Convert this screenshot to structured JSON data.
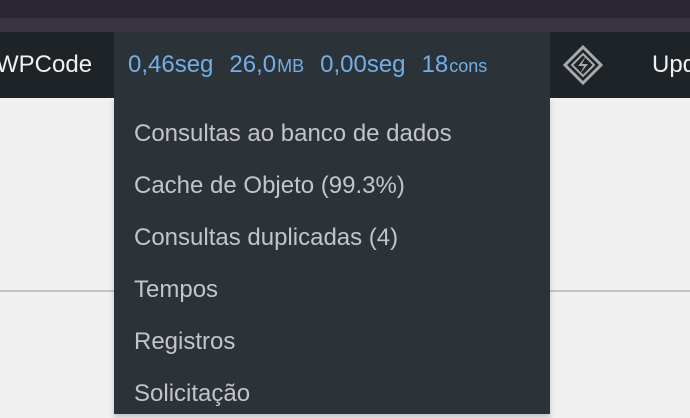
{
  "adminbar": {
    "wpcode_label": "WPCode",
    "qm": {
      "time": {
        "value": "0,46seg"
      },
      "memory": {
        "value": "26,0",
        "unit": "MB"
      },
      "db_time": {
        "value": "0,00seg"
      },
      "queries": {
        "value": "18",
        "unit": "cons"
      }
    },
    "icon": "diamond-logo-icon",
    "updates_label": "Upd"
  },
  "dropdown": {
    "items": [
      {
        "label": "Consultas ao banco de dados"
      },
      {
        "label": "Cache de Objeto (99.3%)"
      },
      {
        "label": "Consultas duplicadas (4)"
      },
      {
        "label": "Tempos"
      },
      {
        "label": "Registros"
      },
      {
        "label": "Solicitação"
      }
    ]
  },
  "colors": {
    "adminbar_bg": "#1d2327",
    "dropdown_bg": "#2c3338",
    "qm_text": "#72aee6",
    "menu_text": "#c3c4c7"
  }
}
